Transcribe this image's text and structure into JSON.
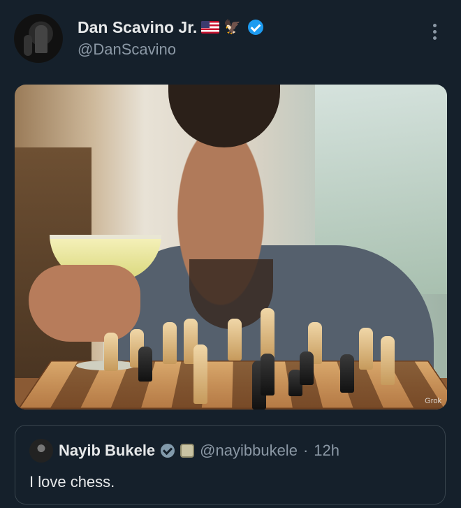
{
  "tweet": {
    "author": {
      "display_name": "Dan Scavino Jr.",
      "handle": "@DanScavino",
      "name_emoji": [
        "us-flag",
        "eagle"
      ],
      "verified": true
    },
    "menu_icon": "more-vertical-icon",
    "media": {
      "watermark": "Grok"
    }
  },
  "quoted_tweet": {
    "author": {
      "display_name": "Nayib Bukele",
      "handle": "@nayibbukele",
      "separator": "·",
      "time": "12h",
      "verified": true,
      "affiliate_badge": "government-seal"
    },
    "text": "I love chess."
  },
  "colors": {
    "background": "#15202b",
    "primary_text": "#e7e9ea",
    "secondary_text": "#8b98a5",
    "verified_blue": "#1d9bf0",
    "verified_gray": "#829aab",
    "border": "#38444d"
  }
}
